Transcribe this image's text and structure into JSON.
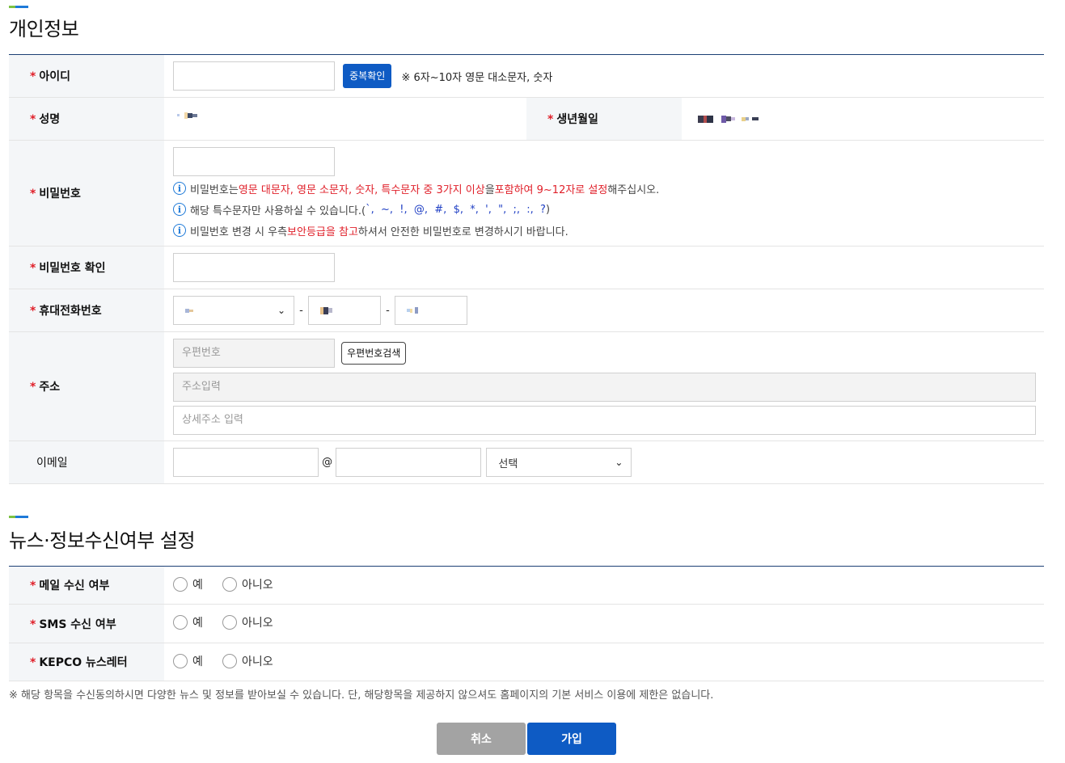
{
  "personal": {
    "title": "개인정보",
    "required_mark": "*",
    "id_label": "아이디",
    "id_value": "",
    "dup_button": "중복확인",
    "id_note": "※ 6자~10자 영문 대소문자, 숫자",
    "name_label": "성명",
    "birth_label": "생년월일",
    "pw_label": "비밀번호",
    "pw_info1_a": "비밀번호는 ",
    "pw_info1_b": "영문 대문자, 영문 소문자, 숫자, 특수문자 중 3가지 이상",
    "pw_info1_c": "을 ",
    "pw_info1_d": "포함하여 9~12자로 설정",
    "pw_info1_e": "해주십시오.",
    "pw_info2_a": "해당 특수문자만 사용하실 수 있습니다.(",
    "pw_info2_b": "`,  ~,  !,  @,  #,  $,  *,  ',  \",  ;,  :,  ?",
    "pw_info2_c": ")",
    "pw_info3_a": "비밀번호 변경 시 우측 ",
    "pw_info3_b": "보안등급을 참고",
    "pw_info3_c": "하셔서 안전한 비밀번호로 변경하시기 바랍니다.",
    "pw_confirm_label": "비밀번호 확인",
    "phone_label": "휴대전화번호",
    "phone_sep": "-",
    "addr_label": "주소",
    "zip_placeholder": "우편번호",
    "zip_button": "우편번호검색",
    "addr_placeholder": "주소입력",
    "addr_detail_placeholder": "상세주소 입력",
    "email_label": "이메일",
    "email_at": "@",
    "email_select": "선택"
  },
  "news": {
    "title": "뉴스·정보수신여부 설정",
    "rows": [
      {
        "label": "메일 수신 여부",
        "yes": "예",
        "no": "아니오"
      },
      {
        "label": "SMS 수신 여부",
        "yes": "예",
        "no": "아니오"
      },
      {
        "label": "KEPCO 뉴스레터",
        "yes": "예",
        "no": "아니오"
      }
    ],
    "footnote": "※ 해당 항목을 수신동의하시면 다양한 뉴스 및 정보를 받아보실 수 있습니다. 단, 해당항목을 제공하지 않으셔도 홈페이지의 기본 서비스 이용에 제한은 없습니다."
  },
  "buttons": {
    "cancel": "취소",
    "join": "가입"
  },
  "colors": {
    "accent": "#0e5bc4",
    "required": "#e0202a",
    "cancel_bg": "#a3a3a3",
    "join_bg": "#0e5bc4",
    "header_bar": "#1c3f74"
  }
}
